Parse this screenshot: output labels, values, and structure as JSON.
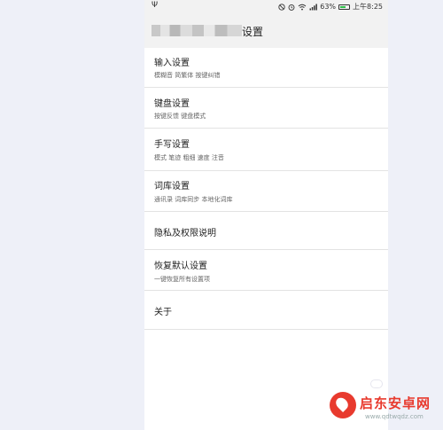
{
  "statusbar": {
    "usb_symbol": "Ψ",
    "icons": [
      "mute-icon",
      "alarm-icon",
      "wifi-icon",
      "signal-icon"
    ],
    "battery_percent": "63%",
    "battery_level": 0.63,
    "time": "上午8:25"
  },
  "header": {
    "title": "设置"
  },
  "settings": {
    "items": [
      {
        "label": "输入设置",
        "sub": "模糊音 简繁体 按键纠错"
      },
      {
        "label": "键盘设置",
        "sub": "按键反馈 键盘模式"
      },
      {
        "label": "手写设置",
        "sub": "模式 笔迹 粗细 速度 注音"
      },
      {
        "label": "词库设置",
        "sub": "通讯录 词库同步 本地化词库"
      },
      {
        "label": "隐私及权限说明"
      },
      {
        "label": "恢复默认设置",
        "sub": "一键恢复所有设置项"
      },
      {
        "label": "关于"
      }
    ]
  },
  "watermark": {
    "name": "启东安卓网",
    "url": "www.qdtwqdz.com"
  },
  "colors": {
    "page_bg": "#eef0f8",
    "bar_bg": "#f2f2f2",
    "battery": "#2fbf4a",
    "watermark": "#e83a2e"
  }
}
